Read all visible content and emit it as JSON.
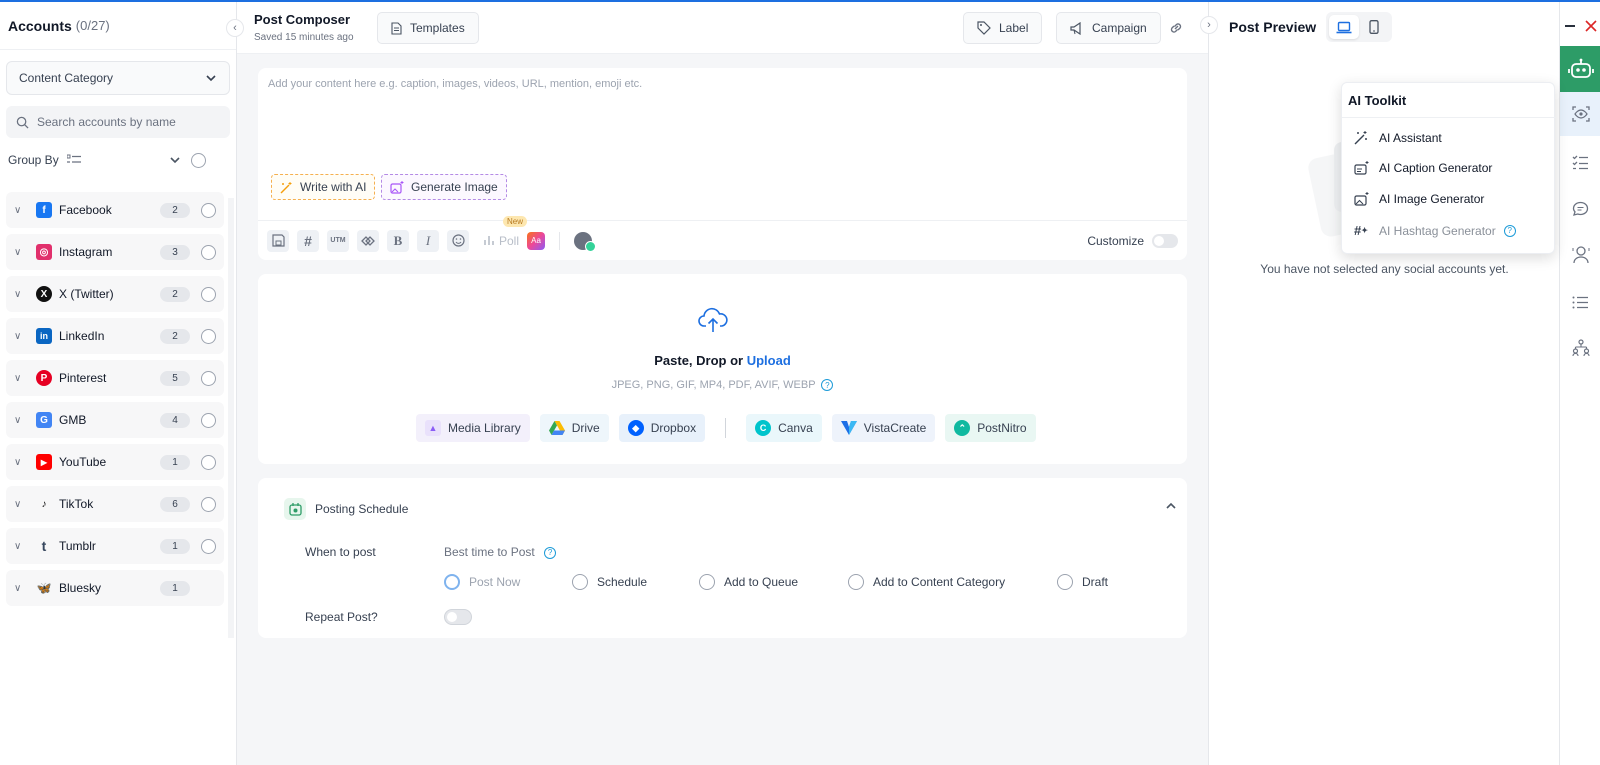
{
  "sidebar": {
    "title": "Accounts",
    "count": "(0/27)",
    "category_select": "Content Category",
    "search_placeholder": "Search accounts by name",
    "group_by_label": "Group By",
    "accounts": [
      {
        "name": "Facebook",
        "count": "2",
        "color": "#1877f2",
        "glyph": "f"
      },
      {
        "name": "Instagram",
        "count": "3",
        "color": "#e1306c",
        "glyph": "◎"
      },
      {
        "name": "X (Twitter)",
        "count": "2",
        "color": "#111111",
        "glyph": "X"
      },
      {
        "name": "LinkedIn",
        "count": "2",
        "color": "#0a66c2",
        "glyph": "in"
      },
      {
        "name": "Pinterest",
        "count": "5",
        "color": "#e60023",
        "glyph": "P"
      },
      {
        "name": "GMB",
        "count": "4",
        "color": "#4285f4",
        "glyph": "G"
      },
      {
        "name": "YouTube",
        "count": "1",
        "color": "#ff0000",
        "glyph": "▶"
      },
      {
        "name": "TikTok",
        "count": "6",
        "color": "#111111",
        "glyph": "♪"
      },
      {
        "name": "Tumblr",
        "count": "1",
        "color": "#36465d",
        "glyph": "t"
      },
      {
        "name": "Bluesky",
        "count": "1",
        "color": "#1185fe",
        "glyph": "🦋"
      }
    ]
  },
  "header": {
    "title": "Post Composer",
    "saved": "Saved 15 minutes ago",
    "templates_label": "Templates",
    "label_label": "Label",
    "campaign_label": "Campaign"
  },
  "composer": {
    "placeholder": "Add your content here e.g. caption, images, videos, URL, mention, emoji etc.",
    "write_ai_label": "Write with AI",
    "generate_image_label": "Generate Image",
    "toolbar": {
      "utm": "UTM",
      "bold": "B",
      "italic": "I",
      "poll": "Poll",
      "new_badge": "New",
      "aa": "Aa",
      "customize": "Customize"
    }
  },
  "upload": {
    "prefix": "Paste, Drop or ",
    "link": "Upload",
    "formats": "JPEG, PNG, GIF, MP4, PDF, AVIF, WEBP",
    "help": "?",
    "sources": {
      "media_library": "Media Library",
      "drive": "Drive",
      "dropbox": "Dropbox",
      "canva": "Canva",
      "vistacreate": "VistaCreate",
      "postnitro": "PostNitro"
    }
  },
  "schedule": {
    "title": "Posting Schedule",
    "when_label": "When to post",
    "best_time": "Best time to Post",
    "options": [
      "Post Now",
      "Schedule",
      "Add to Queue",
      "Add to Content Category",
      "Draft"
    ],
    "selected": "Post Now",
    "repeat_label": "Repeat Post?"
  },
  "preview": {
    "title": "Post Preview",
    "empty_message": "You have not selected any social accounts yet."
  },
  "toolkit": {
    "title": "AI Toolkit",
    "items": [
      "AI Assistant",
      "AI Caption Generator",
      "AI Image Generator",
      "AI Hashtag Generator"
    ]
  },
  "colors": {
    "accent": "#1d6fe0",
    "green": "#2d9c67"
  }
}
